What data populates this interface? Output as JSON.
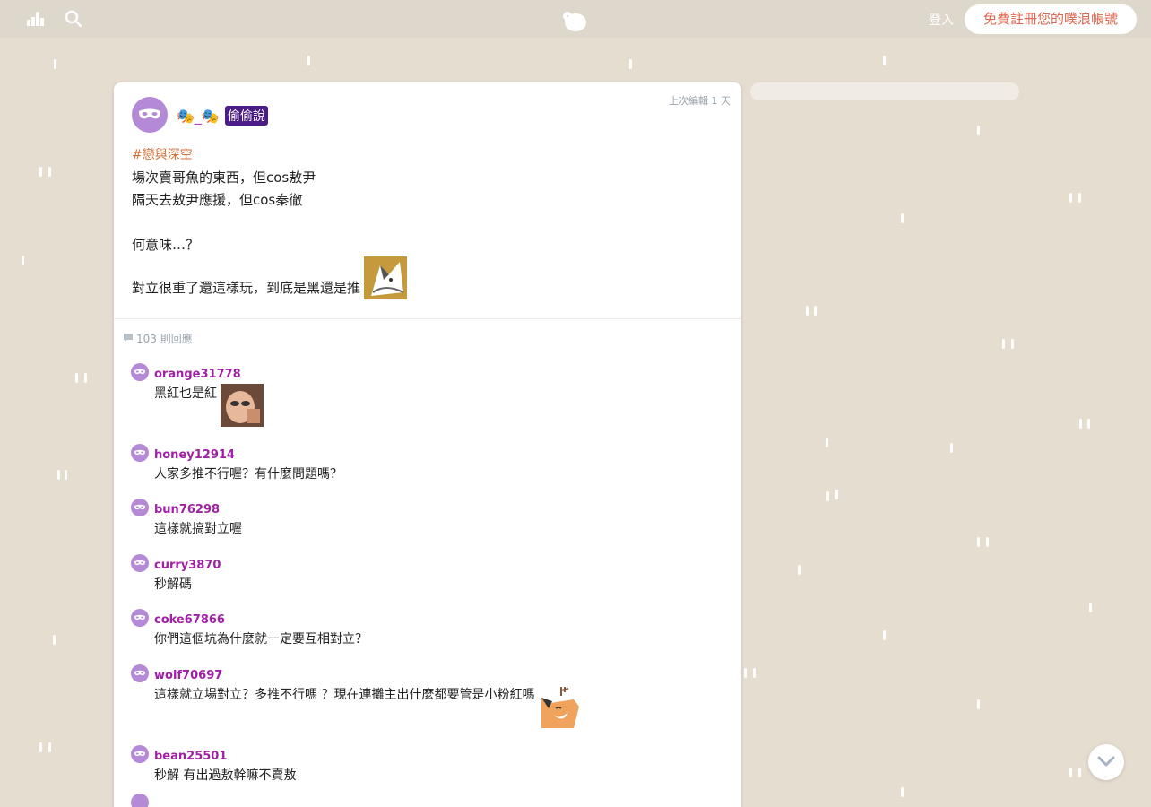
{
  "topbar": {
    "login_label": "登入",
    "signup_label": "免費註冊您的噗浪帳號"
  },
  "post": {
    "edit_time": "上次編輯 1 天",
    "username": "🎭_🎭",
    "anon_badge": "偷偷說",
    "hashtag": "#戀與深空",
    "lines": [
      "場次賣哥魚的東西，但cos敖尹",
      "隔天去敖尹應援，但cos秦徹",
      "",
      "何意味…？",
      "對立很重了還這樣玩，到底是黑還是推"
    ],
    "reply_count": "103 則回應"
  },
  "replies": [
    {
      "user": "orange31778",
      "text": "黑紅也是紅"
    },
    {
      "user": "honey12914",
      "text": "人家多推不行喔？有什麼問題嗎？"
    },
    {
      "user": "bun76298",
      "text": "這樣就搞對立喔"
    },
    {
      "user": "curry3870",
      "text": "秒解碼"
    },
    {
      "user": "coke67866",
      "text": "你們這個坑為什麼就一定要互相對立？"
    },
    {
      "user": "wolf70697",
      "text": "這樣就立場對立？多推不行嗎 ？現在連攤主出什麼都要管是小粉紅嗎"
    },
    {
      "user": "bean25501",
      "text": "秒解 有出過敖幹嘛不賣敖"
    }
  ],
  "colors": {
    "background": "#e6ddd1",
    "topbar": "#ddd7cc",
    "username": "#a020a6",
    "badge": "#4b1b87",
    "hashtag": "#d26f3a",
    "signup_text": "#e0654e",
    "mask_avatar": "#b48ad6"
  },
  "icons": [
    "sheep-icon",
    "search-icon",
    "plurk-logo-icon",
    "mask-avatar-icon",
    "comment-bubble-icon",
    "chevron-down-icon"
  ]
}
